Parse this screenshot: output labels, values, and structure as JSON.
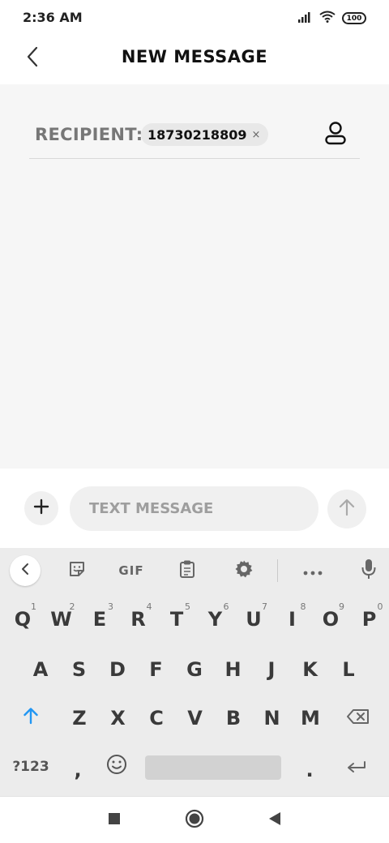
{
  "status_bar": {
    "time": "2:36 AM",
    "battery": "100",
    "icons": [
      "signal-icon",
      "wifi-icon",
      "battery-icon"
    ]
  },
  "header": {
    "title": "NEW MESSAGE",
    "back_icon": "chevron-left-icon"
  },
  "recipient": {
    "label": "RECIPIENT:",
    "chip_value": "18730218809",
    "chip_remove": "×",
    "contact_icon": "person-icon"
  },
  "composer": {
    "placeholder": "TEXT MESSAGE",
    "value": "",
    "add_icon": "plus-icon",
    "send_icon": "arrow-up-icon"
  },
  "keyboard": {
    "toolbar": {
      "back_icon": "chevron-left-icon",
      "sticker_icon": "sticker-icon",
      "gif_label": "GIF",
      "clipboard_icon": "clipboard-icon",
      "settings_icon": "gear-icon",
      "more_icon": "more-icon",
      "mic_icon": "microphone-icon"
    },
    "row1": [
      {
        "key": "Q",
        "hint": "1"
      },
      {
        "key": "W",
        "hint": "2"
      },
      {
        "key": "E",
        "hint": "3"
      },
      {
        "key": "R",
        "hint": "4"
      },
      {
        "key": "T",
        "hint": "5"
      },
      {
        "key": "Y",
        "hint": "6"
      },
      {
        "key": "U",
        "hint": "7"
      },
      {
        "key": "I",
        "hint": "8"
      },
      {
        "key": "O",
        "hint": "9"
      },
      {
        "key": "P",
        "hint": "0"
      }
    ],
    "row2": [
      "A",
      "S",
      "D",
      "F",
      "G",
      "H",
      "J",
      "K",
      "L"
    ],
    "row3": [
      "Z",
      "X",
      "C",
      "V",
      "B",
      "N",
      "M"
    ],
    "symbols_label": "?123",
    "comma": ",",
    "period": ".",
    "shift_icon": "shift-arrow-icon",
    "backspace_icon": "backspace-icon",
    "emoji_icon": "emoji-icon",
    "enter_icon": "enter-icon"
  },
  "nav_bar": {
    "recent_icon": "square-icon",
    "home_icon": "circle-icon",
    "back_icon": "triangle-back-icon"
  },
  "colors": {
    "shift_accent": "#2196f3",
    "content_bg": "#f6f6f6",
    "keyboard_bg": "#ececec"
  }
}
